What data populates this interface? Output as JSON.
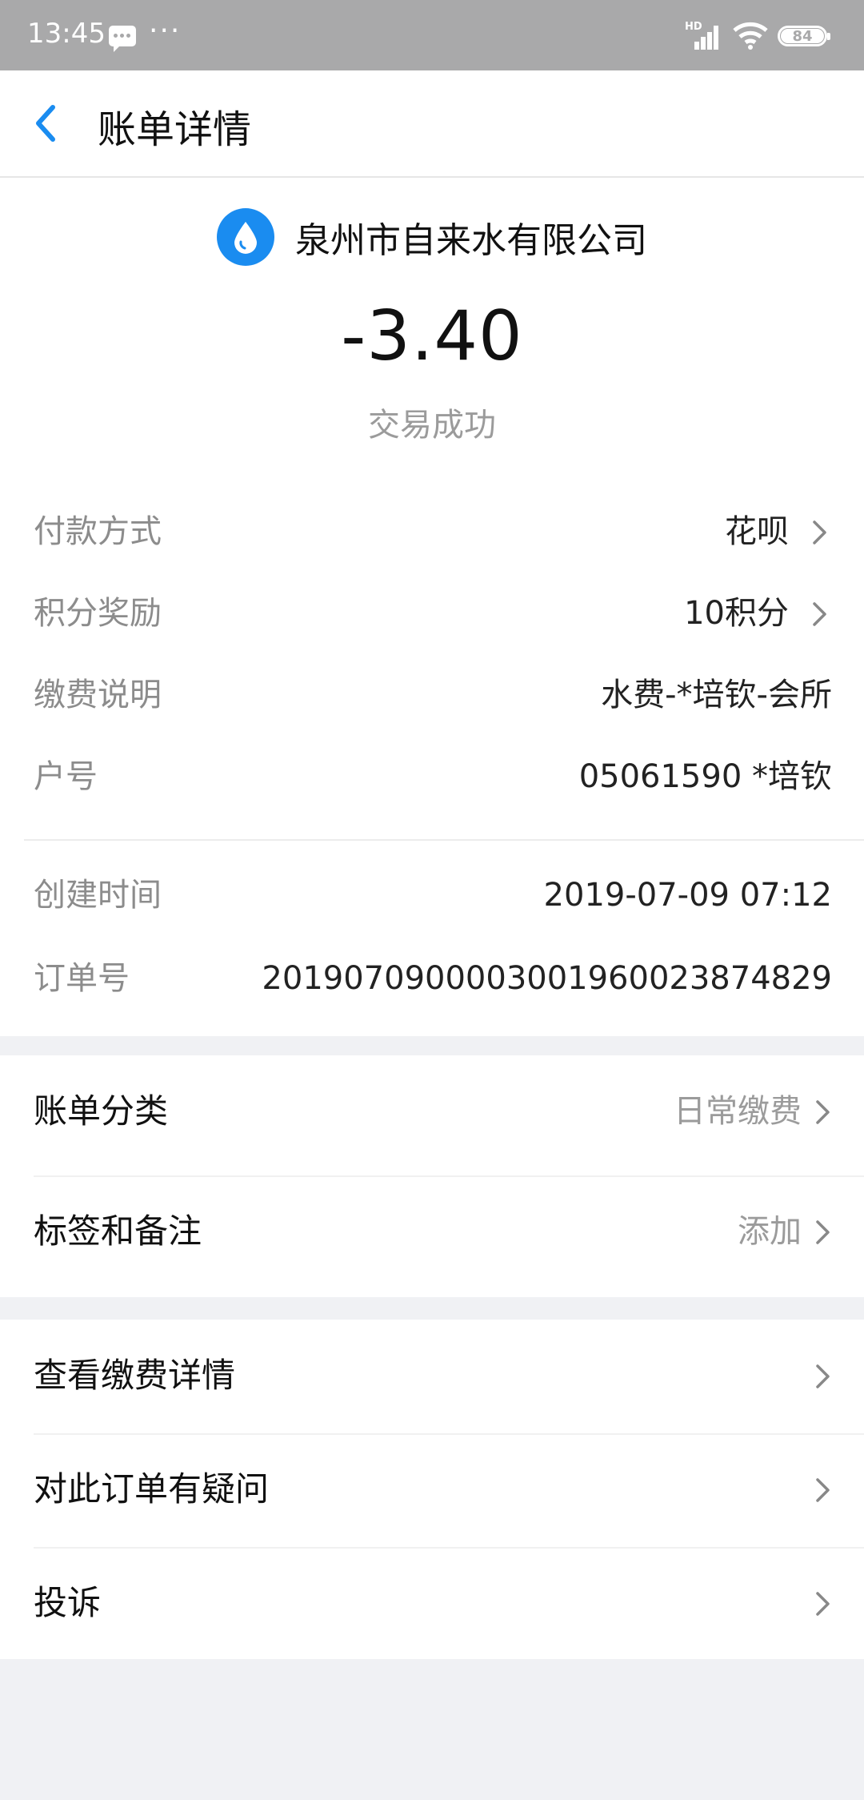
{
  "status_bar": {
    "time": "13:45",
    "dots": "···",
    "network": "HD",
    "battery": "84"
  },
  "nav": {
    "title": "账单详情"
  },
  "summary": {
    "merchant": "泉州市自来水有限公司",
    "amount": "-3.40",
    "status": "交易成功"
  },
  "details": [
    {
      "label": "付款方式",
      "value": "花呗",
      "arrow": true
    },
    {
      "label": "积分奖励",
      "value": "10积分",
      "arrow": true
    },
    {
      "label": "缴费说明",
      "value": "水费-*培钦-会所",
      "arrow": false
    },
    {
      "label": "户号",
      "value": "05061590 *培钦",
      "arrow": false
    }
  ],
  "meta": [
    {
      "label": "创建时间",
      "value": "2019-07-09 07:12"
    },
    {
      "label": "订单号",
      "value": "20190709000030019600238748​29"
    }
  ],
  "section1": [
    {
      "label": "账单分类",
      "value": "日常缴费"
    },
    {
      "label": "标签和备注",
      "value": "添加"
    }
  ],
  "section2": [
    {
      "label": "查看缴费详情"
    },
    {
      "label": "对此订单有疑问"
    },
    {
      "label": "投诉"
    }
  ],
  "colors": {
    "accent": "#1a8cf0",
    "muted": "#9b9b9b",
    "statusbar": "#a9a9aa"
  }
}
